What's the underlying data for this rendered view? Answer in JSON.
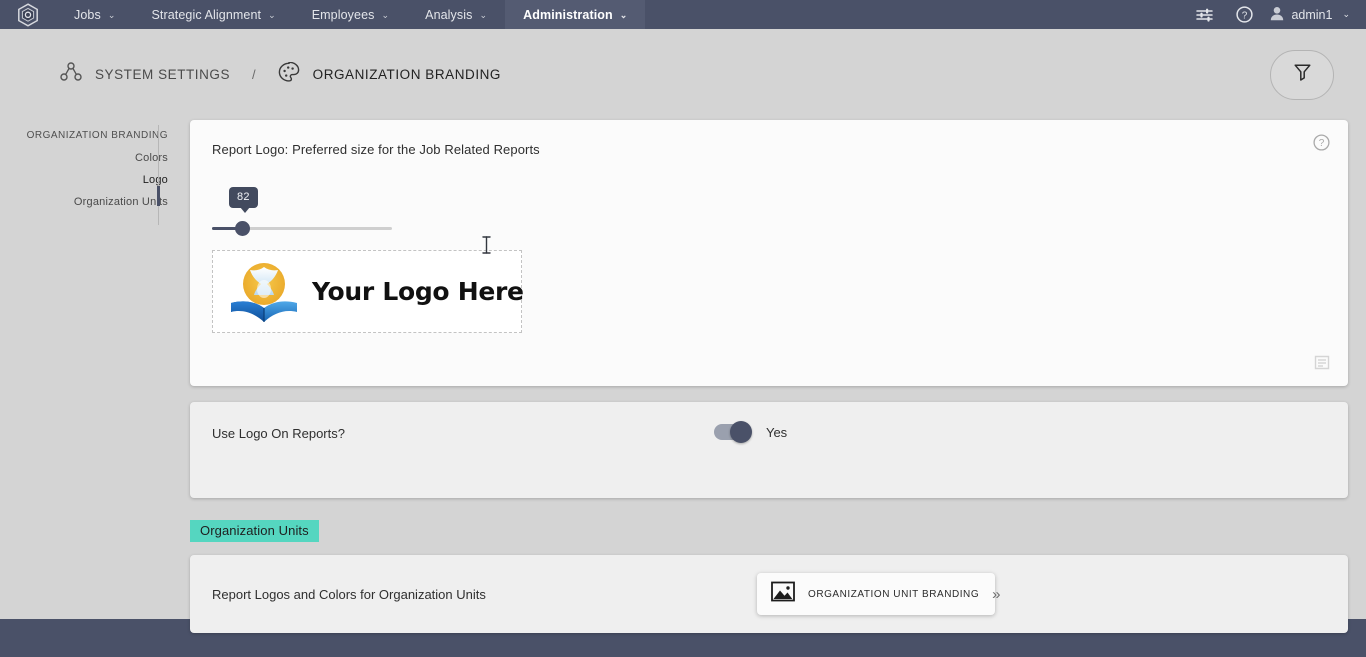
{
  "topnav": {
    "brand_icon": "cube-logo-icon",
    "items": [
      {
        "label": "Jobs",
        "has_caret": true,
        "active": false
      },
      {
        "label": "Strategic Alignment",
        "has_caret": true,
        "active": false
      },
      {
        "label": "Employees",
        "has_caret": true,
        "active": false
      },
      {
        "label": "Analysis",
        "has_caret": true,
        "active": false
      },
      {
        "label": "Administration",
        "has_caret": true,
        "active": true
      }
    ],
    "caret": "⌄",
    "tune_icon": "tune-sliders-icon",
    "help_icon": "help-circle-icon",
    "user": {
      "name": "admin1",
      "icon": "user-avatar-icon"
    }
  },
  "breadcrumb": {
    "parent": {
      "label": "SYSTEM SETTINGS",
      "icon": "org-nodes-icon"
    },
    "separator": "/",
    "current": {
      "label": "ORGANIZATION BRANDING",
      "icon": "palette-icon"
    },
    "filter_button": {
      "icon": "filter-funnel-icon"
    }
  },
  "sidebar": {
    "items": [
      {
        "label": "ORGANIZATION BRANDING",
        "selected": false,
        "heading": true
      },
      {
        "label": "Colors",
        "selected": false,
        "heading": false
      },
      {
        "label": "Logo",
        "selected": true,
        "heading": false
      },
      {
        "label": "Organization Units",
        "selected": false,
        "heading": false
      }
    ]
  },
  "logo_card": {
    "title": "Report Logo: Preferred size for the Job Related Reports",
    "help_icon": "help-circle-icon",
    "doc_icon": "document-lines-icon",
    "slider": {
      "value": "82",
      "min": 0,
      "max": 500,
      "percent": 17
    },
    "preview": {
      "alt_text": "Your Logo Here",
      "emblem_icon": "globe-book-emblem-icon"
    }
  },
  "toggle_card": {
    "label": "Use Logo On Reports?",
    "value": "Yes",
    "checked": true
  },
  "section": {
    "heading": "Organization Units"
  },
  "bottom_card": {
    "label": "Report Logos and Colors for Organization Units",
    "button": {
      "label": "ORGANIZATION UNIT BRANDING",
      "icon": "image-picture-icon",
      "chevron": "»"
    }
  },
  "colors": {
    "nav_bg": "#4a5168",
    "nav_active_bg": "#545b72",
    "page_bg": "#d4d4d4",
    "card_bg": "#efefef",
    "card_white": "#fbfbfb",
    "accent_teal": "#55d6c0",
    "slider_dark": "#4a5168"
  }
}
